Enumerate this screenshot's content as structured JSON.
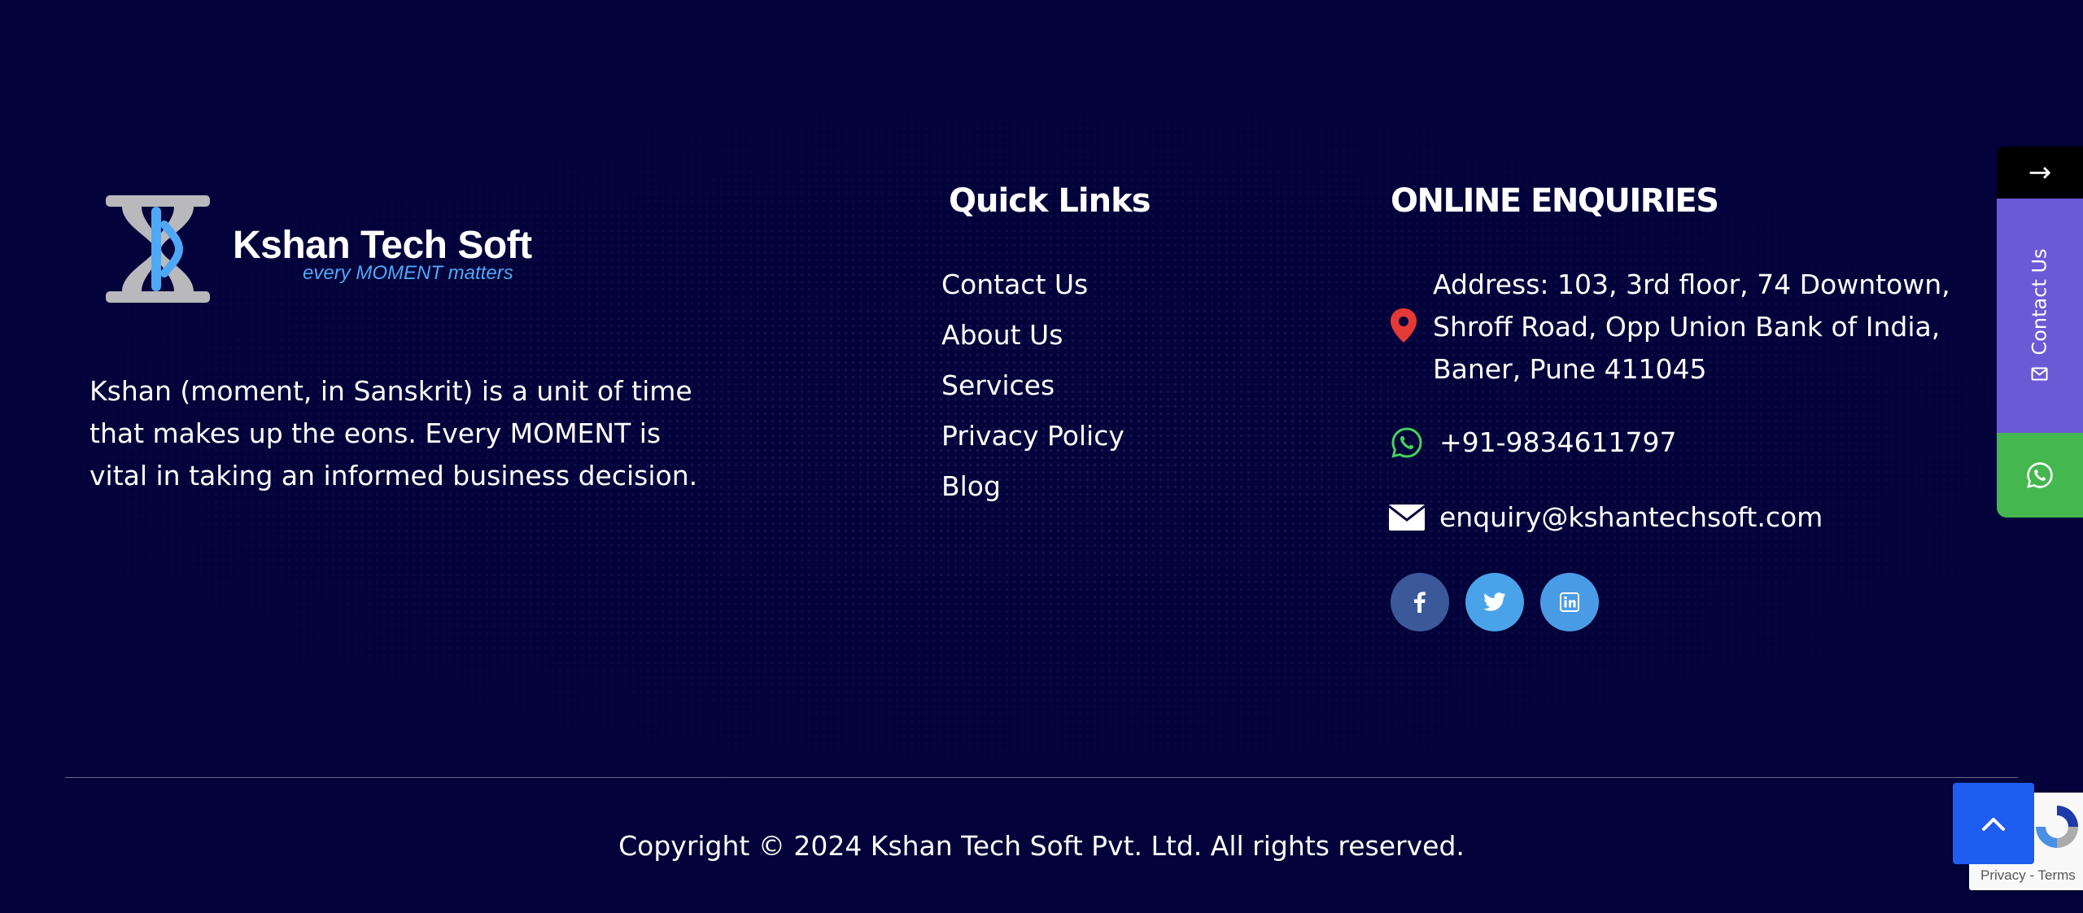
{
  "brand": {
    "name": "Kshan Tech Soft",
    "tagline": "every MOMENT matters",
    "description": "Kshan (moment, in Sanskrit) is a unit of time that makes up the eons. Every MOMENT is vital in taking an informed business decision."
  },
  "quick_links": {
    "heading": "Quick Links",
    "items": [
      "Contact Us",
      "About Us",
      "Services",
      "Privacy Policy",
      "Blog"
    ]
  },
  "enquiries": {
    "heading": "ONLINE ENQUIRIES",
    "address": "Address: 103, 3rd floor, 74 Downtown, Shroff Road, Opp Union Bank of India, Baner, Pune 411045",
    "phone": "+91-9834611797",
    "email": "enquiry@kshantechsoft.com",
    "socials": [
      "facebook-icon",
      "twitter-icon",
      "linkedin-icon"
    ]
  },
  "footer": {
    "copyright": "Copyright © 2024 Kshan Tech Soft Pvt. Ltd. All rights reserved."
  },
  "side_tabs": {
    "arrow": "→",
    "contact_label": "Contact Us"
  },
  "recaptcha": {
    "text": "Privacy - Terms"
  },
  "colors": {
    "background": "#03023a",
    "accent_blue": "#4ea8f5",
    "contact_tab": "#6b5ad6",
    "whatsapp": "#45b74f",
    "scroll_top": "#1f5cf0",
    "facebook": "#3b5998",
    "twitter": "#4aa3e8",
    "linkedin": "#4a9be6"
  }
}
